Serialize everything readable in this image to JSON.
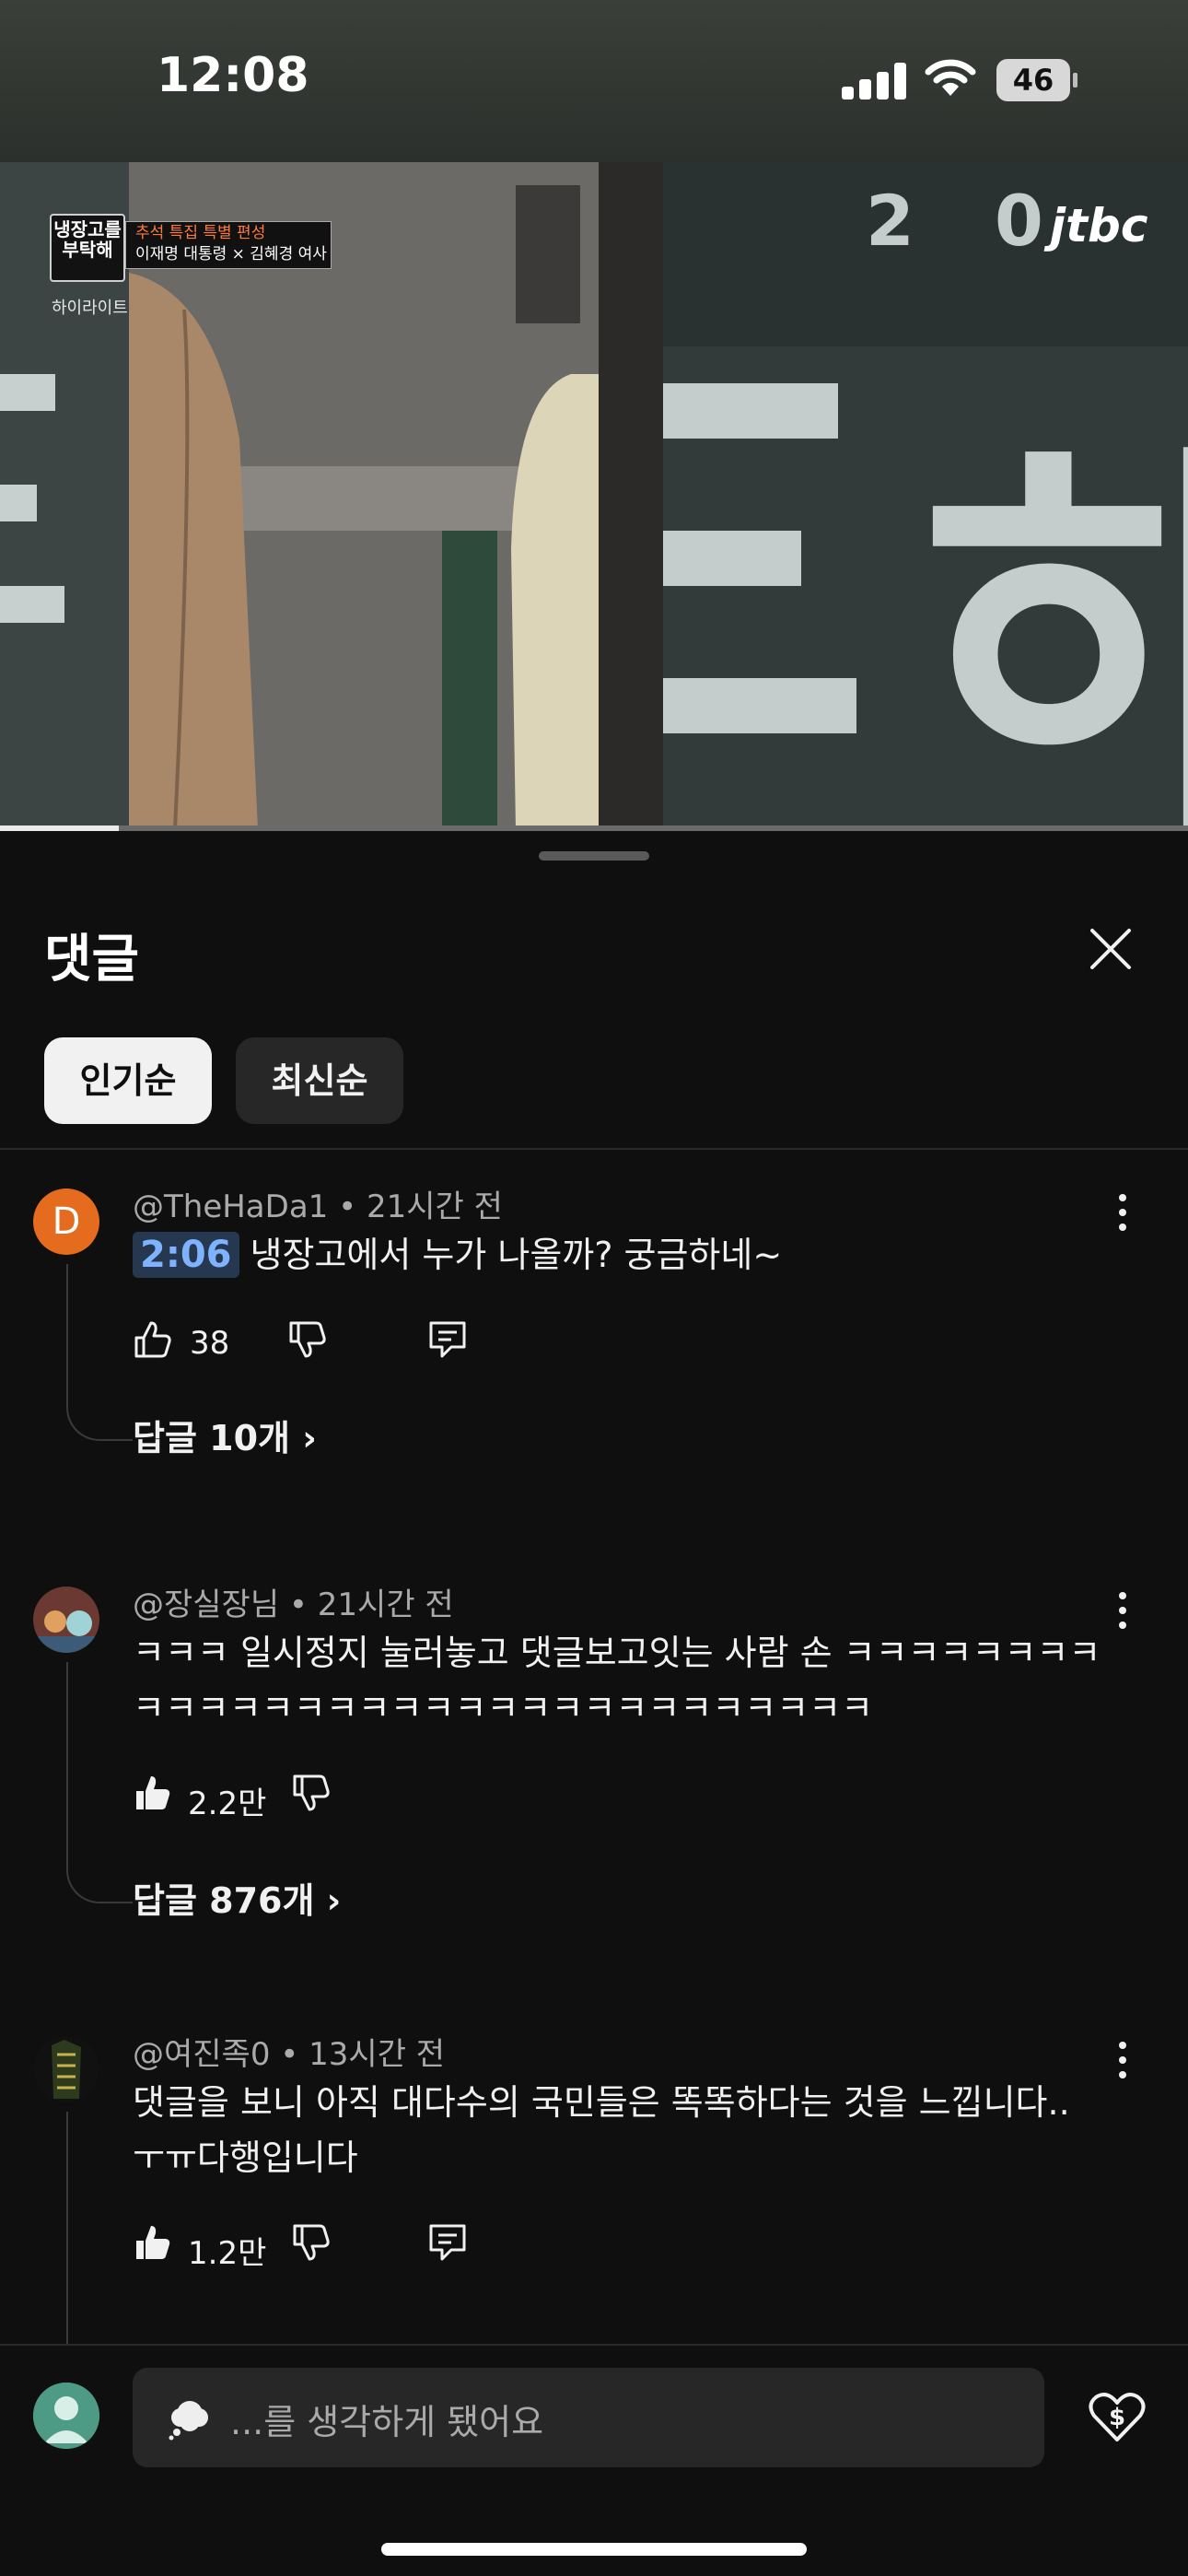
{
  "status_bar": {
    "time": "12:08",
    "battery": "46"
  },
  "video": {
    "show_logo": "냉장고를 부탁해",
    "highlight_label": "하이라이트",
    "banner_line1": "추석 특집 특별 편성",
    "banner_line2": "이재명 대통령 × 김혜경 여사",
    "channel": "jtbc",
    "progress_fraction": 0.1
  },
  "panel": {
    "title": "댓글",
    "sort_tabs": [
      {
        "label": "인기순",
        "active": true
      },
      {
        "label": "최신순",
        "active": false
      }
    ]
  },
  "comments": [
    {
      "avatar_letter": "D",
      "author": "@TheHaDa1",
      "time": "21시간 전",
      "timestamp": "2:06",
      "text": "냉장고에서 누가 나올까? 궁금하네~",
      "likes": "38",
      "liked": false,
      "replies_label": "답글 10개"
    },
    {
      "author": "@장실장님",
      "time": "21시간 전",
      "text": "ㅋㅋㅋ 일시정지 눌러놓고 댓글보고잇는 사람 손 ㅋㅋㅋㅋㅋㅋㅋㅋㅋㅋㅋㅋㅋㅋㅋㅋㅋㅋㅋㅋㅋㅋㅋㅋㅋㅋㅋㅋㅋㅋㅋ",
      "likes": "2.2만",
      "liked": true,
      "replies_label": "답글 876개"
    },
    {
      "author": "@여진족0",
      "time": "13시간 전",
      "text": "댓글을 보니 아직 대다수의 국민들은 똑똑하다는 것을 느낍니다.. ㅜㅠ다행입니다",
      "likes": "1.2만",
      "liked": true
    }
  ],
  "composer": {
    "placeholder": "...를 생각하게 됐어요"
  },
  "icons": {
    "close": "close-icon",
    "like": "thumbs-up-icon",
    "dislike": "thumbs-down-icon",
    "reply": "reply-icon",
    "more": "more-vertical-icon",
    "super_thanks": "super-thanks-icon"
  },
  "colors": {
    "accent_timestamp": "#7fb3ff",
    "avatar_orange": "#e56b1f"
  }
}
